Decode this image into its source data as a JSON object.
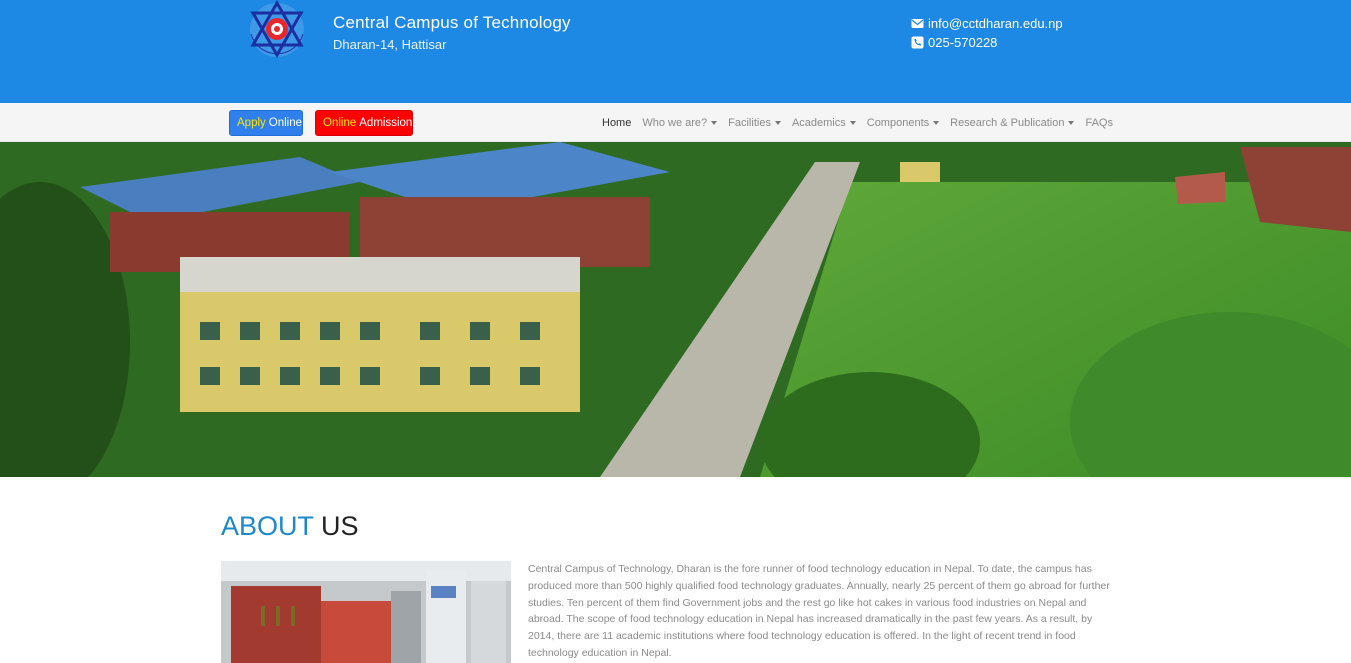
{
  "header": {
    "title": "Central Campus of Technology",
    "subtitle": "Dharan-14, Hattisar",
    "logo_text": "CENTRAL CAMPUS OF TECHNOLOGY",
    "email": "info@cctdharan.edu.np",
    "phone": "025-570228",
    "brand_color": "#1e88e5"
  },
  "nav": {
    "apply_highlight": "Apply",
    "apply_rest": "Online",
    "admission_highlight": "Online",
    "admission_rest": "Admission",
    "items": [
      {
        "label": "Home",
        "dropdown": false
      },
      {
        "label": "Who we are?",
        "dropdown": true
      },
      {
        "label": "Facilities",
        "dropdown": true
      },
      {
        "label": "Academics",
        "dropdown": true
      },
      {
        "label": "Components",
        "dropdown": true
      },
      {
        "label": "Research & Publication",
        "dropdown": true
      },
      {
        "label": "FAQs",
        "dropdown": false
      }
    ]
  },
  "about": {
    "heading_accent": "ABOUT",
    "heading_rest": "US",
    "text": "Central Campus of Technology, Dharan is the fore runner of food technology education in Nepal. To date, the campus has produced more than 500 highly qualified food technology graduates. Annually, nearly 25 percent of them go abroad for further studies. Ten percent of them find Government jobs and the rest go like hot cakes in various food industries on Nepal and abroad. The scope of food technology education in Nepal has increased dramatically in the past few years. As a result, by 2014, there are 11 academic institutions where food technology education is offered. In the light of recent trend in food technology education in Nepal."
  }
}
